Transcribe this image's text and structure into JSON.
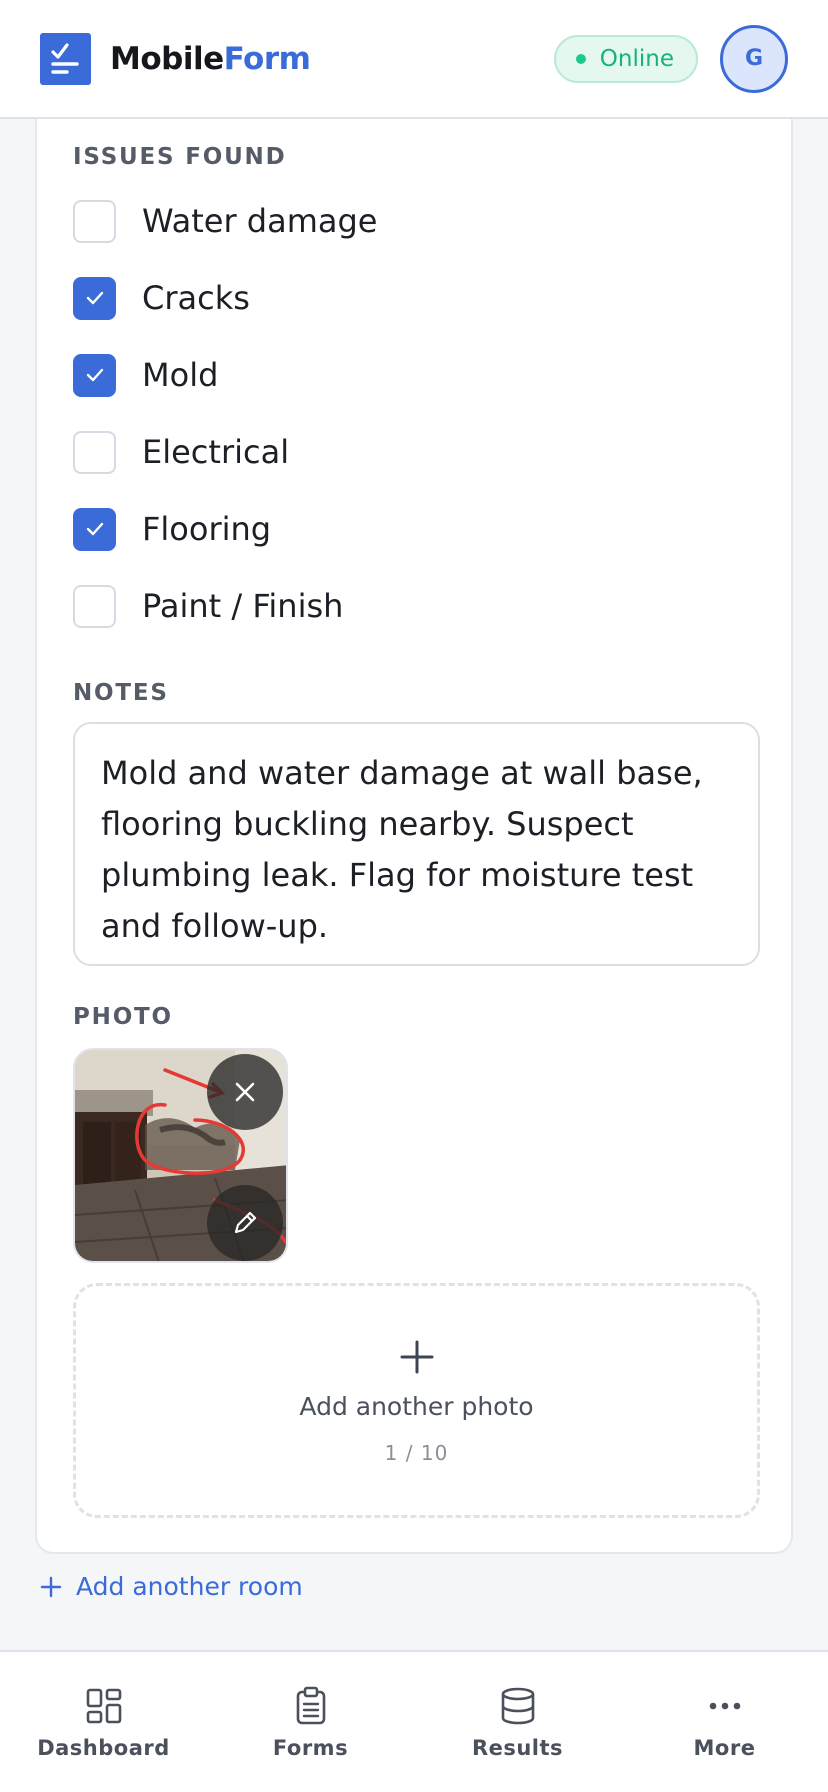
{
  "header": {
    "brand_part1": "Mobile",
    "brand_part2": "Form",
    "status": "Online",
    "avatar_initial": "G"
  },
  "issues": {
    "label": "ISSUES FOUND",
    "items": [
      {
        "label": "Water damage",
        "checked": false
      },
      {
        "label": "Cracks",
        "checked": true
      },
      {
        "label": "Mold",
        "checked": true
      },
      {
        "label": "Electrical",
        "checked": false
      },
      {
        "label": "Flooring",
        "checked": true
      },
      {
        "label": "Paint / Finish",
        "checked": false
      }
    ]
  },
  "notes": {
    "label": "NOTES",
    "value": "Mold and water damage at wall base, flooring buckling nearby. Suspect plumbing leak. Flag for moisture test and follow-up."
  },
  "photo": {
    "label": "PHOTO",
    "add_label": "Add another photo",
    "count": "1 / 10"
  },
  "add_room_label": "Add another room",
  "nav": {
    "items": [
      {
        "label": "Dashboard",
        "icon": "dashboard-icon"
      },
      {
        "label": "Forms",
        "icon": "clipboard-icon"
      },
      {
        "label": "Results",
        "icon": "database-icon"
      },
      {
        "label": "More",
        "icon": "more-dots-icon"
      }
    ]
  },
  "colors": {
    "accent": "#3a6bd8",
    "online": "#16b27a",
    "annotation": "#e53935"
  }
}
